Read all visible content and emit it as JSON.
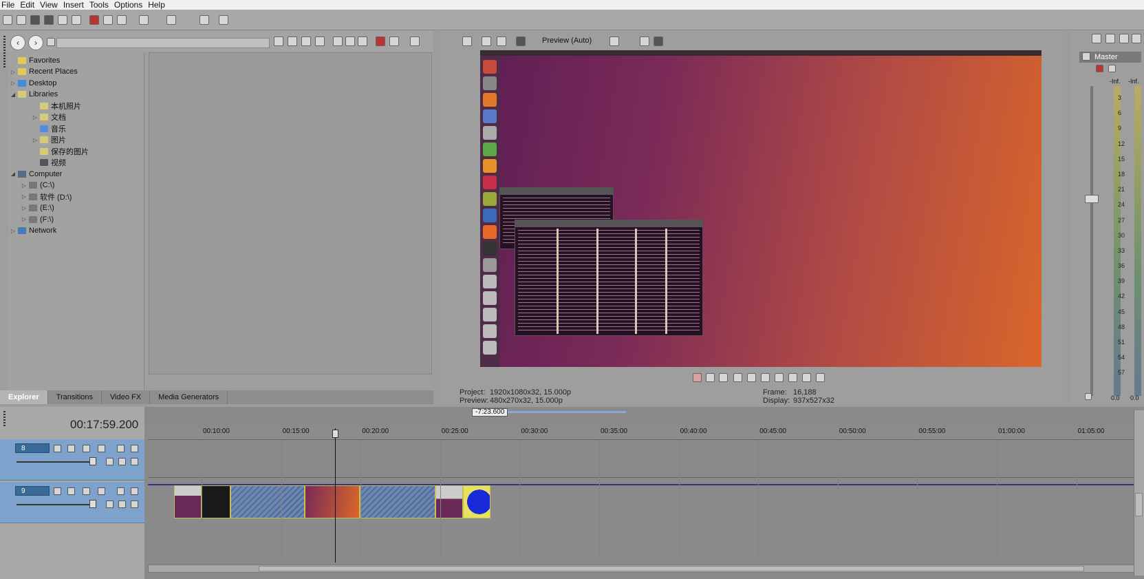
{
  "menu": [
    "File",
    "Edit",
    "View",
    "Insert",
    "Tools",
    "Options",
    "Help"
  ],
  "explorer": {
    "tree": [
      {
        "label": "Favorites",
        "depth": 0,
        "expander": "",
        "icon": "star-folder-icon"
      },
      {
        "label": "Recent Places",
        "depth": 0,
        "expander": "▷",
        "icon": "folder-icon"
      },
      {
        "label": "Desktop",
        "depth": 0,
        "expander": "▷",
        "icon": "desktop-icon"
      },
      {
        "label": "Libraries",
        "depth": 0,
        "expander": "◢",
        "icon": "library-icon"
      },
      {
        "label": "本机照片",
        "depth": 2,
        "expander": "",
        "icon": "library-icon"
      },
      {
        "label": "文档",
        "depth": 2,
        "expander": "▷",
        "icon": "library-icon"
      },
      {
        "label": "音乐",
        "depth": 2,
        "expander": "",
        "icon": "music-icon"
      },
      {
        "label": "图片",
        "depth": 2,
        "expander": "▷",
        "icon": "library-icon"
      },
      {
        "label": "保存的图片",
        "depth": 2,
        "expander": "",
        "icon": "library-icon"
      },
      {
        "label": "视频",
        "depth": 2,
        "expander": "",
        "icon": "video-icon"
      },
      {
        "label": "Computer",
        "depth": 0,
        "expander": "◢",
        "icon": "computer-icon"
      },
      {
        "label": "(C:\\)",
        "depth": 1,
        "expander": "▷",
        "icon": "drive-icon"
      },
      {
        "label": "软件 (D:\\)",
        "depth": 1,
        "expander": "▷",
        "icon": "drive-icon"
      },
      {
        "label": "(E:\\)",
        "depth": 1,
        "expander": "▷",
        "icon": "drive-icon"
      },
      {
        "label": "(F:\\)",
        "depth": 1,
        "expander": "▷",
        "icon": "drive-icon"
      },
      {
        "label": "Network",
        "depth": 0,
        "expander": "▷",
        "icon": "network-icon"
      }
    ],
    "tabs": [
      "Explorer",
      "Transitions",
      "Video FX",
      "Media Generators"
    ],
    "active_tab": "Explorer"
  },
  "preview": {
    "mode_label": "Preview (Auto)",
    "project_label": "Project:",
    "project_value": "1920x1080x32, 15.000p",
    "preview_label": "Preview:",
    "preview_value": "480x270x32, 15.000p",
    "frame_label": "Frame:",
    "frame_value": "16,188",
    "display_label": "Display:",
    "display_value": "937x527x32"
  },
  "master": {
    "title": "Master",
    "left_value": "0.0",
    "right_value": "0.0",
    "inf_left": "-Inf.",
    "inf_right": "-Inf.",
    "db_scale": [
      "3",
      "6",
      "9",
      "12",
      "15",
      "18",
      "21",
      "24",
      "27",
      "30",
      "33",
      "36",
      "39",
      "42",
      "45",
      "48",
      "51",
      "54",
      "57"
    ]
  },
  "timeline": {
    "current_time": "00:17:59.200",
    "loop_region": "-7:23.600",
    "ruler_labels": [
      "00:10:00",
      "00:15:00",
      "00:20:00",
      "00:25:00",
      "00:30:00",
      "00:35:00",
      "00:40:00",
      "00:45:00",
      "00:50:00",
      "00:55:00",
      "01:00:00",
      "01:05:00"
    ],
    "tracks": [
      {
        "number": "8"
      },
      {
        "number": "9"
      }
    ]
  },
  "colors": {
    "track_header": "#7da3cc",
    "clip_border": "#c8c050",
    "wallpaper_start": "#5e1f54",
    "wallpaper_end": "#d9662a"
  }
}
